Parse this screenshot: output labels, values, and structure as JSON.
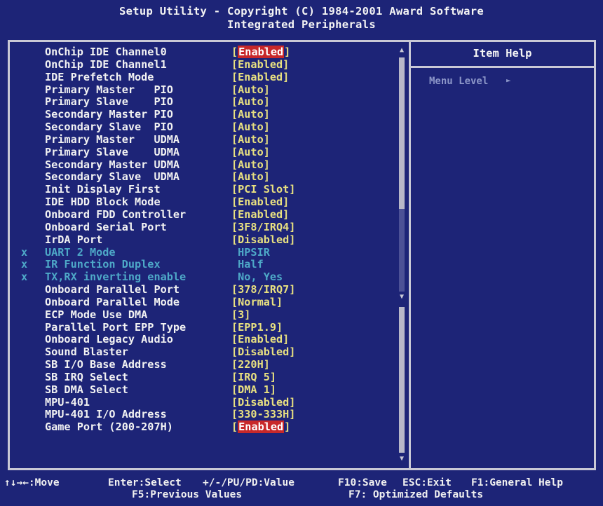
{
  "header": {
    "title": "Setup Utility - Copyright (C) 1984-2001 Award Software",
    "subtitle": "Integrated Peripherals"
  },
  "help_panel": {
    "title": "Item Help",
    "menu_level_label": "Menu Level",
    "menu_level_icon": "right-arrow-icon"
  },
  "settings": [
    {
      "label": "OnChip IDE Channel0",
      "value": "[Enabled]",
      "selected": true,
      "disabled": false
    },
    {
      "label": "OnChip IDE Channel1",
      "value": "[Enabled]",
      "selected": false,
      "disabled": false
    },
    {
      "label": "IDE Prefetch Mode",
      "value": "[Enabled]",
      "selected": false,
      "disabled": false
    },
    {
      "label": "Primary Master   PIO",
      "value": "[Auto]",
      "selected": false,
      "disabled": false
    },
    {
      "label": "Primary Slave    PIO",
      "value": "[Auto]",
      "selected": false,
      "disabled": false
    },
    {
      "label": "Secondary Master PIO",
      "value": "[Auto]",
      "selected": false,
      "disabled": false
    },
    {
      "label": "Secondary Slave  PIO",
      "value": "[Auto]",
      "selected": false,
      "disabled": false
    },
    {
      "label": "Primary Master   UDMA",
      "value": "[Auto]",
      "selected": false,
      "disabled": false
    },
    {
      "label": "Primary Slave    UDMA",
      "value": "[Auto]",
      "selected": false,
      "disabled": false
    },
    {
      "label": "Secondary Master UDMA",
      "value": "[Auto]",
      "selected": false,
      "disabled": false
    },
    {
      "label": "Secondary Slave  UDMA",
      "value": "[Auto]",
      "selected": false,
      "disabled": false
    },
    {
      "label": "Init Display First",
      "value": "[PCI Slot]",
      "selected": false,
      "disabled": false
    },
    {
      "label": "IDE HDD Block Mode",
      "value": "[Enabled]",
      "selected": false,
      "disabled": false
    },
    {
      "label": "Onboard FDD Controller",
      "value": "[Enabled]",
      "selected": false,
      "disabled": false
    },
    {
      "label": "Onboard Serial Port",
      "value": "[3F8/IRQ4]",
      "selected": false,
      "disabled": false
    },
    {
      "label": "IrDA Port",
      "value": "[Disabled]",
      "selected": false,
      "disabled": false
    },
    {
      "label": "UART 2 Mode",
      "value": " HPSIR",
      "selected": false,
      "disabled": true,
      "mark": "x"
    },
    {
      "label": "IR Function Duplex",
      "value": " Half",
      "selected": false,
      "disabled": true,
      "mark": "x"
    },
    {
      "label": "TX,RX inverting enable",
      "value": " No, Yes",
      "selected": false,
      "disabled": true,
      "mark": "x"
    },
    {
      "label": "Onboard Parallel Port",
      "value": "[378/IRQ7]",
      "selected": false,
      "disabled": false
    },
    {
      "label": "Onboard Parallel Mode",
      "value": "[Normal]",
      "selected": false,
      "disabled": false
    },
    {
      "label": "ECP Mode Use DMA",
      "value": "[3]",
      "selected": false,
      "disabled": false
    },
    {
      "label": "Parallel Port EPP Type",
      "value": "[EPP1.9]",
      "selected": false,
      "disabled": false
    },
    {
      "label": "Onboard Legacy Audio",
      "value": "[Enabled]",
      "selected": false,
      "disabled": false
    },
    {
      "label": "Sound Blaster",
      "value": "[Disabled]",
      "selected": false,
      "disabled": false
    },
    {
      "label": "SB I/O Base Address",
      "value": "[220H]",
      "selected": false,
      "disabled": false
    },
    {
      "label": "SB IRQ Select",
      "value": "[IRQ 5]",
      "selected": false,
      "disabled": false
    },
    {
      "label": "SB DMA Select",
      "value": "[DMA 1]",
      "selected": false,
      "disabled": false
    },
    {
      "label": "MPU-401",
      "value": "[Disabled]",
      "selected": false,
      "disabled": false
    },
    {
      "label": "MPU-401 I/O Address",
      "value": "[330-333H]",
      "selected": false,
      "disabled": false
    },
    {
      "label": "Game Port (200-207H)",
      "value": "[Enabled]",
      "selected": true,
      "disabled": false
    }
  ],
  "footer": {
    "move": "↑↓→←:Move",
    "select": "Enter:Select",
    "value": "+/-/PU/PD:Value",
    "save": "F10:Save",
    "exit": "ESC:Exit",
    "general_help": "F1:General Help",
    "previous_values": "F5:Previous Values",
    "optimized_defaults": "F7: Optimized Defaults"
  },
  "colors": {
    "background": "#1d2477",
    "value_text": "#e8e080",
    "disabled_text": "#4ea9c8",
    "highlight": "#c8282a"
  }
}
